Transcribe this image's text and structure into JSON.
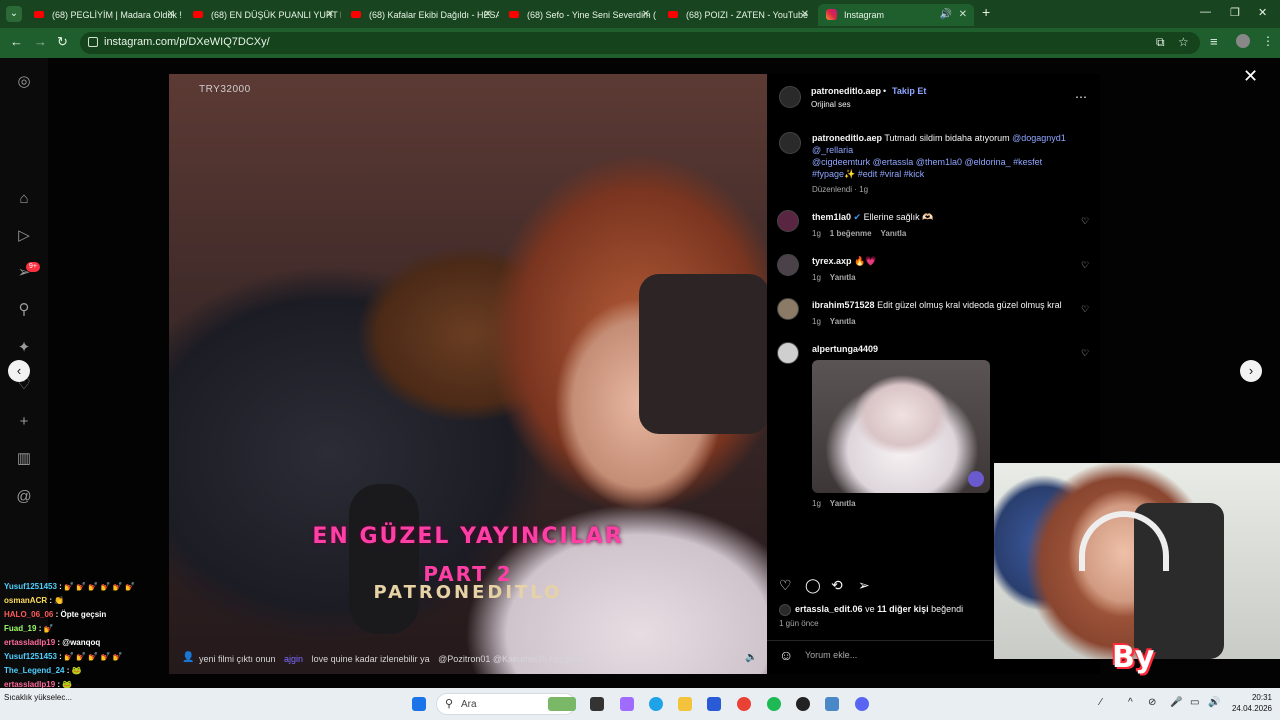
{
  "browser": {
    "tabs": [
      {
        "title": "(68) PEGLİYİM | Madara Olduk !!"
      },
      {
        "title": "(68) EN DÜŞÜK PUANLI YURT D"
      },
      {
        "title": "(68) Kafalar Ekibi Dağıldı - HESA"
      },
      {
        "title": "(68) Sefo - Yine Seni Severdim ("
      },
      {
        "title": "(68) POIZI - ZATEN - YouTube"
      },
      {
        "title": "Instagram"
      }
    ],
    "url": "instagram.com/p/DXeWIQ7DCXy/"
  },
  "video": {
    "watermark": "TRY32000",
    "caption_line1": "EN GÜZEL YAYINCILAR",
    "caption_line2": "PART 2",
    "caption_line3": "PATRONEDITLO",
    "ticker": [
      {
        "user": "",
        "text": "yeni filmi çıktı onun"
      },
      {
        "user": "ajgin",
        "text": "love quine kadar izlenebilir ya"
      },
      {
        "user": "",
        "text": "@Pozitron01 @Kakumei35 hoşgeldin"
      }
    ]
  },
  "post": {
    "author": "patroneditlo.aep",
    "follow_label": "Takip Et",
    "audio": "Orijinal ses",
    "caption_user": "patroneditlo.aep",
    "caption_text": "Tutmadı sildim bidaha atıyorum",
    "caption_tags_1": "@dogagnyd1",
    "caption_tags_2": "@_rellaria",
    "caption_tags_3": "@cigdeemturk @ertassla @them1la0 @eldorina_ #kesfet",
    "caption_tags_4": "#fypage✨ #edit #viral #kick",
    "edited_meta": "Düzenlendi · 1g",
    "comments": [
      {
        "user": "them1la0",
        "text": "Ellerine sağlık 🫶🏻",
        "time": "1g",
        "likes": "1 beğenme",
        "reply": "Yanıtla"
      },
      {
        "user": "tyrex.axp",
        "text": "🔥💗",
        "time": "1g",
        "reply": "Yanıtla"
      },
      {
        "user": "ibrahim571528",
        "text": "Edit güzel olmuş kral videoda güzel olmuş kral",
        "time": "1g",
        "reply": "Yanıtla"
      },
      {
        "user": "alpertunga4409",
        "text": "",
        "time": "1g",
        "reply": "Yanıtla"
      }
    ],
    "liked_by_user": "ertassla_edit.06",
    "liked_by_rest": "ve",
    "liked_by_others": "11 diğer kişi",
    "liked_by_suffix": "beğendi",
    "posted_ago": "1 gün önce",
    "comment_placeholder": "Yorum ekle..."
  },
  "overlay_label": "By",
  "chat": [
    {
      "user": "Yusuf1251453",
      "msg": ": 💅 💅 💅 💅 💅 💅",
      "color": "#4fd0ff"
    },
    {
      "user": "osmanACR",
      "msg": ": 👏",
      "color": "#ffde5c"
    },
    {
      "user": "HALO_06_06",
      "msg": ": Öpte geçsin",
      "color": "#ff5a5a"
    },
    {
      "user": "Fuad_19",
      "msg": ": 💅",
      "color": "#9cff6a"
    },
    {
      "user": "ertassladlp19",
      "msg": ": @wanqoq",
      "color": "#ff6a9c"
    },
    {
      "user": "The_Legend_24",
      "msg": ": 🐸",
      "color": "#4fd0ff"
    },
    {
      "user": "Yusuf1251453",
      "msg": ": 💅 💅 💅 💅 💅",
      "color": "#4fd0ff"
    },
    {
      "user": "ertassladlp19",
      "msg": ": 🐸",
      "color": "#ff6a9c"
    }
  ],
  "taskbar": {
    "search_label": "Ara",
    "time": "20:31",
    "date": "24.04.2026",
    "notification": "Sıcaklık yükselec..."
  }
}
